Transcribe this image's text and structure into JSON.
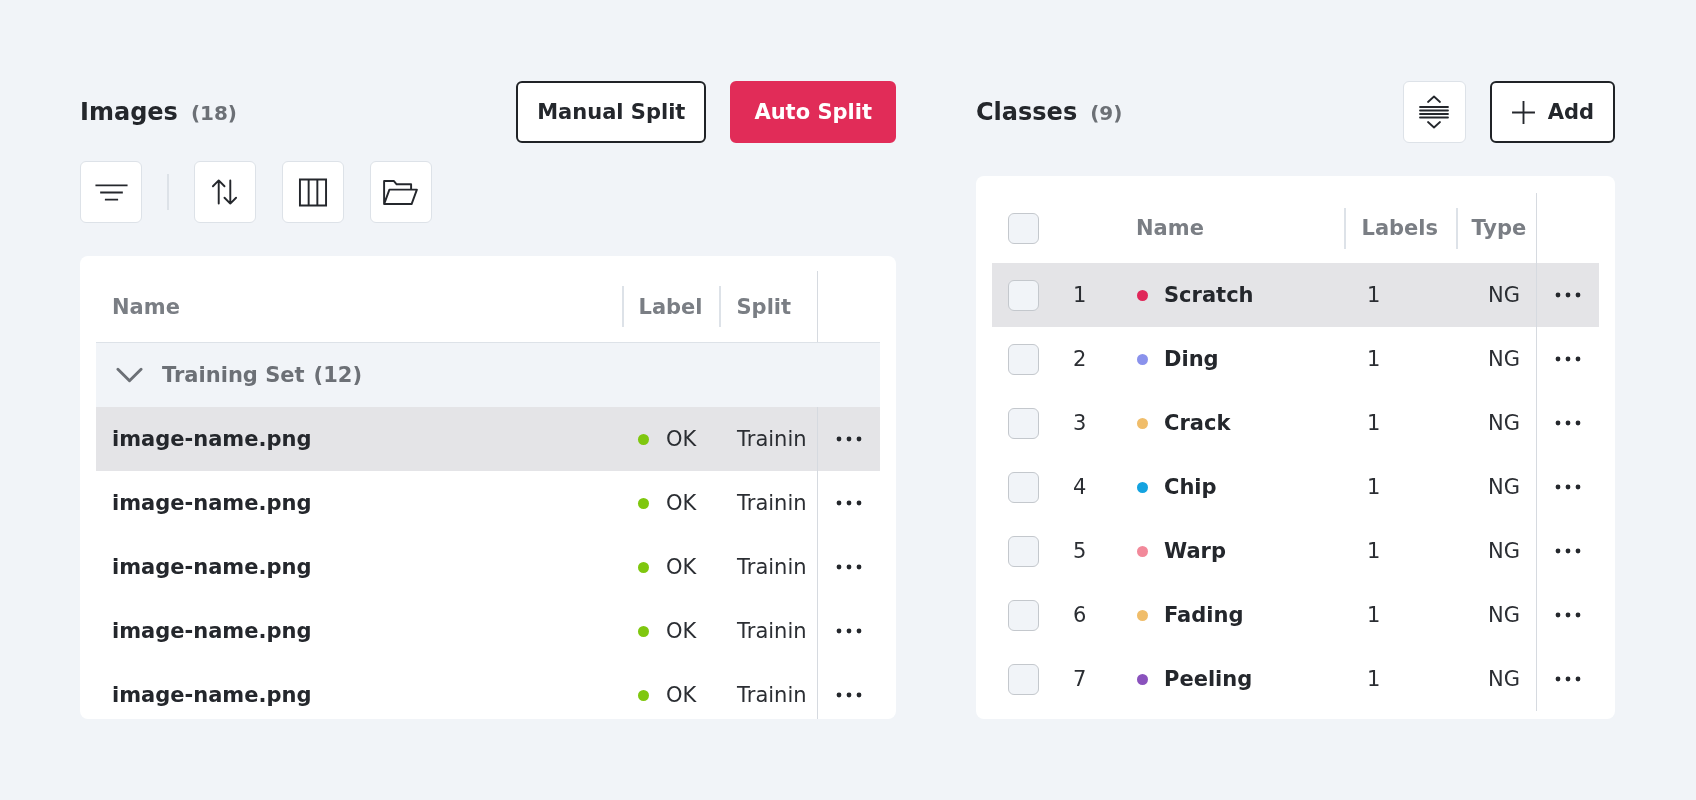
{
  "images_panel": {
    "title": "Images",
    "count": "(18)",
    "buttons": [
      {
        "label": "Manual Split",
        "kind": "outline"
      },
      {
        "label": "Auto Split",
        "kind": "primary"
      }
    ],
    "table": {
      "columns": [
        "Name",
        "Label",
        "Split"
      ],
      "groups": [
        {
          "label": "Training Set",
          "count": "(12)",
          "expanded": true,
          "rows": [
            {
              "name": "image-name.png",
              "label": "OK",
              "color": "#7fc70f",
              "split": "Trainin",
              "selected": true
            },
            {
              "name": "image-name.png",
              "label": "OK",
              "color": "#7fc70f",
              "split": "Trainin",
              "selected": false
            },
            {
              "name": "image-name.png",
              "label": "OK",
              "color": "#7fc70f",
              "split": "Trainin",
              "selected": false
            },
            {
              "name": "image-name.png",
              "label": "OK",
              "color": "#7fc70f",
              "split": "Trainin",
              "selected": false
            },
            {
              "name": "image-name.png",
              "label": "OK",
              "color": "#7fc70f",
              "split": "Trainin",
              "selected": false
            }
          ]
        }
      ]
    }
  },
  "classes_panel": {
    "title": "Classes",
    "count": "(9)",
    "add_button": {
      "label": "Add"
    },
    "table": {
      "header_checkbox": {
        "checked": false
      },
      "columns": [
        "Name",
        "Labels",
        "Type"
      ],
      "rows": [
        {
          "number": "1",
          "name": "Scratch",
          "color": "#e0275a",
          "labels": "1",
          "type": "NG",
          "checked": false,
          "selected": true
        },
        {
          "number": "2",
          "name": "Ding",
          "color": "#8a92ec",
          "labels": "1",
          "type": "NG",
          "checked": false,
          "selected": false
        },
        {
          "number": "3",
          "name": "Crack",
          "color": "#f0bd6a",
          "labels": "1",
          "type": "NG",
          "checked": false,
          "selected": false
        },
        {
          "number": "4",
          "name": "Chip",
          "color": "#14a3e0",
          "labels": "1",
          "type": "NG",
          "checked": false,
          "selected": false
        },
        {
          "number": "5",
          "name": "Warp",
          "color": "#f2899a",
          "labels": "1",
          "type": "NG",
          "checked": false,
          "selected": false
        },
        {
          "number": "6",
          "name": "Fading",
          "color": "#f0bd6a",
          "labels": "1",
          "type": "NG",
          "checked": false,
          "selected": false
        },
        {
          "number": "7",
          "name": "Peeling",
          "color": "#8a52bd",
          "labels": "1",
          "type": "NG",
          "checked": false,
          "selected": false
        }
      ]
    }
  }
}
